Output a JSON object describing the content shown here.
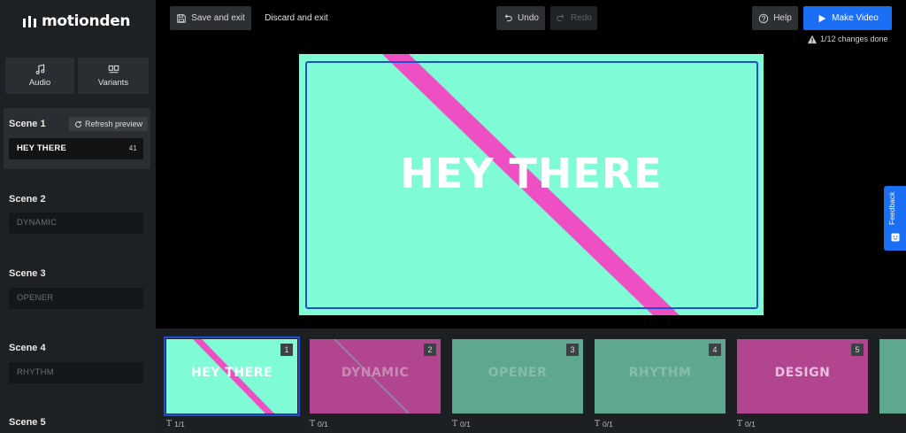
{
  "brand": {
    "name": "motionden"
  },
  "sidebar": {
    "tools": [
      {
        "label": "Audio",
        "icon": "music-note-icon"
      },
      {
        "label": "Variants",
        "icon": "variants-icon"
      }
    ],
    "refresh_label": "Refresh preview",
    "scenes": [
      {
        "title": "Scene 1",
        "text": "HEY THERE",
        "count": "41",
        "active": true
      },
      {
        "title": "Scene 2",
        "text": "DYNAMIC"
      },
      {
        "title": "Scene 3",
        "text": "OPENER"
      },
      {
        "title": "Scene 4",
        "text": "RHYTHM"
      },
      {
        "title": "Scene 5"
      }
    ]
  },
  "toolbar": {
    "save_exit": "Save and exit",
    "discard_exit": "Discard and exit",
    "undo": "Undo",
    "redo": "Redo",
    "help": "Help",
    "make_video": "Make Video",
    "changes_status": "1/12 changes done"
  },
  "preview": {
    "headline": "HEY THERE"
  },
  "timeline": {
    "thumbs": [
      {
        "label": "HEY THERE",
        "num": "1",
        "count": "1/1",
        "bg": "#7ffcd6",
        "selected": true
      },
      {
        "label": "DYNAMIC",
        "num": "2",
        "count": "0/1",
        "bg": "#b2458f"
      },
      {
        "label": "OPENER",
        "num": "3",
        "count": "0/1",
        "bg": "#5fa88f"
      },
      {
        "label": "RHYTHM",
        "num": "4",
        "count": "0/1",
        "bg": "#5fa88f"
      },
      {
        "label": "DESIGN",
        "num": "5",
        "count": "0/1",
        "bg": "#b2458f"
      }
    ]
  },
  "feedback": {
    "label": "Feedback"
  },
  "colors": {
    "accent": "#1a6ff5",
    "stripe": "#ee4fc3",
    "frame": "#1f4fd8",
    "mint": "#7ffcd6"
  }
}
